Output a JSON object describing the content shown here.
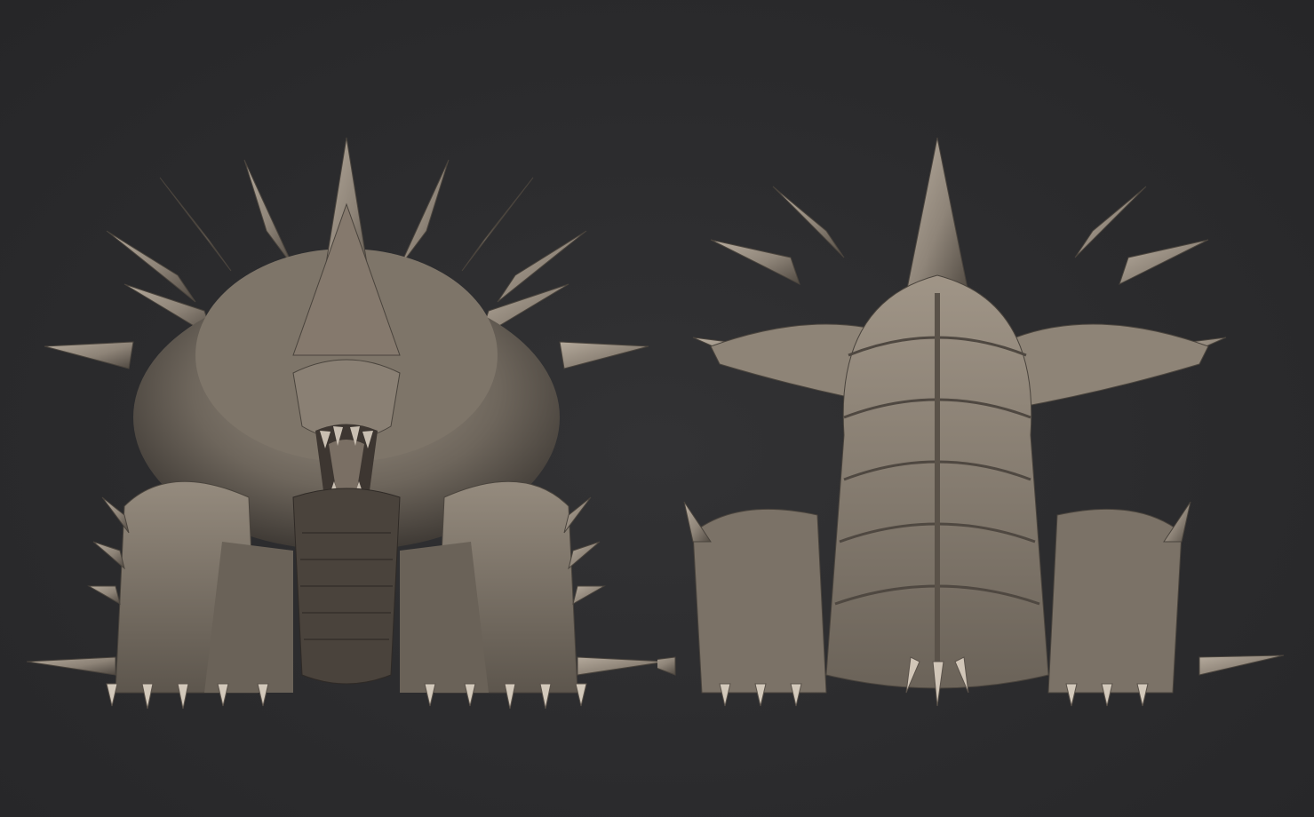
{
  "scene": {
    "background_color": "#2b2b2d",
    "material_color": "#8f8579",
    "views": [
      {
        "id": "front",
        "subject": "spiked-beast-front"
      },
      {
        "id": "back",
        "subject": "spiked-beast-back"
      }
    ]
  }
}
